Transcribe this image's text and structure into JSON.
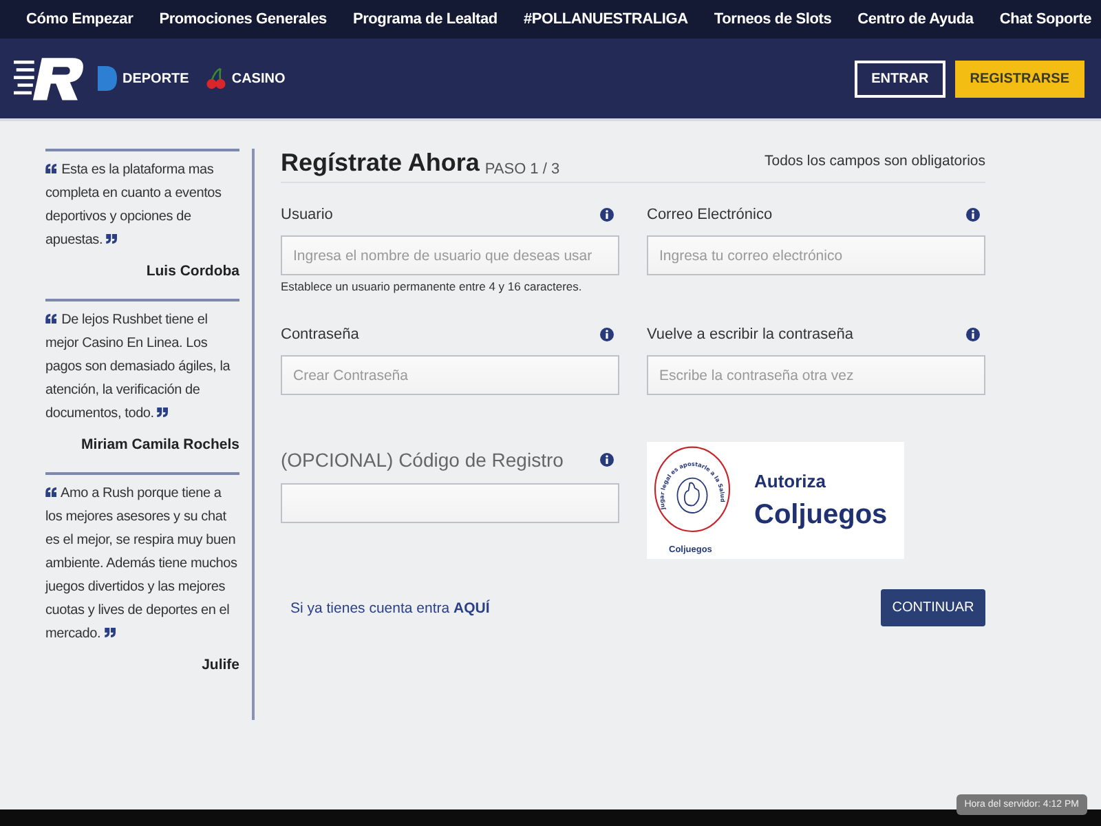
{
  "top_nav": [
    "Cómo Empezar",
    "Promociones Generales",
    "Programa de Lealtad",
    "#POLLANUESTRALIGA",
    "Torneos de Slots",
    "Centro de Ayuda",
    "Chat Soporte"
  ],
  "header": {
    "sections": [
      {
        "kind": "deporte",
        "label": "DEPORTE"
      },
      {
        "kind": "casino",
        "label": "CASINO"
      }
    ],
    "login_button": "ENTRAR",
    "register_button": "REGISTRARSE"
  },
  "testimonials": [
    {
      "quote": "Esta es la plataforma mas completa en cuanto a eventos deportivos y opciones de apuestas.",
      "author": "Luis Cordoba"
    },
    {
      "quote": "De lejos Rushbet tiene el mejor Casino En Linea. Los pagos son demasiado ágiles, la atención, la verificación de documentos, todo.",
      "author": "Miriam Camila Rochels"
    },
    {
      "quote": "Amo a Rush porque tiene a los mejores asesores y su chat es el mejor, se respira muy buen ambiente. Además tiene muchos juegos divertidos y las mejores cuotas y lives de deportes en el mercado.",
      "author": "Julife"
    }
  ],
  "form": {
    "title": "Regístrate Ahora",
    "step": "PASO 1 / 3",
    "required_note": "Todos los campos son obligatorios",
    "fields": [
      {
        "label": "Usuario",
        "placeholder": "Ingresa el nombre de usuario que deseas usar",
        "hint": "Establece un usuario permanente entre 4 y 16 caracteres."
      },
      {
        "label": "Correo Electrónico",
        "placeholder": "Ingresa tu correo electrónico"
      },
      {
        "label": "Contraseña",
        "placeholder": "Crear Contraseña"
      },
      {
        "label": "Vuelve a escribir la contraseña",
        "placeholder": "Escribe la contraseña otra vez"
      }
    ],
    "promo_code": {
      "label": "(OPCIONAL) Código de Registro"
    },
    "regulator": {
      "seal_text": "Jugar legal es apostarle a la Salud",
      "seal_name": "Coljuegos",
      "caption": "Autoriza",
      "name": "Coljuegos"
    },
    "login_prompt": "Si ya tienes cuenta entra",
    "login_link": "AQUÍ",
    "continue_button": "CONTINUAR"
  },
  "server_time": "Hora del servidor: 4:12 PM"
}
